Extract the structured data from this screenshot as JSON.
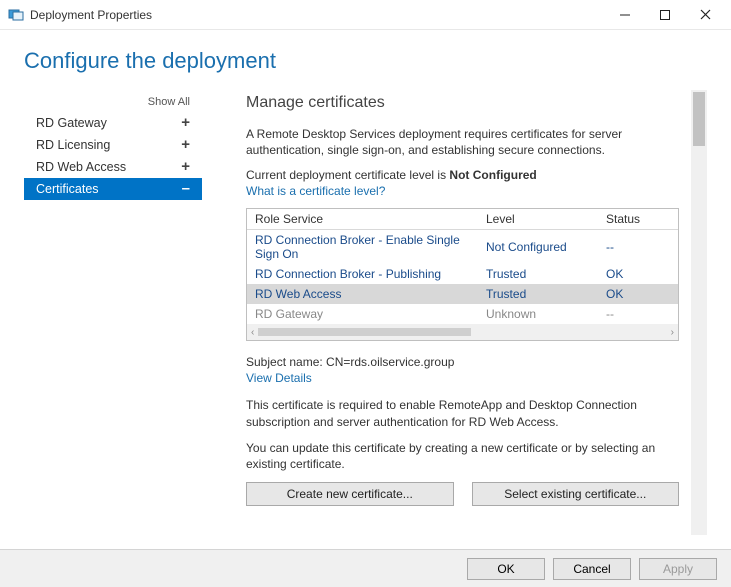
{
  "window": {
    "title": "Deployment Properties"
  },
  "heading": "Configure the deployment",
  "sidebar": {
    "show_all": "Show All",
    "items": [
      {
        "label": "RD Gateway",
        "expander": "+",
        "active": false
      },
      {
        "label": "RD Licensing",
        "expander": "+",
        "active": false
      },
      {
        "label": "RD Web Access",
        "expander": "+",
        "active": false
      },
      {
        "label": "Certificates",
        "expander": "–",
        "active": true
      }
    ]
  },
  "panel": {
    "title": "Manage certificates",
    "intro": "A Remote Desktop Services deployment requires certificates for server authentication, single sign-on, and establishing secure connections.",
    "status_line_prefix": "Current deployment certificate level is ",
    "status_value": "Not Configured",
    "what_link": "What is a certificate level?",
    "table": {
      "headers": {
        "role": "Role Service",
        "level": "Level",
        "status": "Status"
      },
      "rows": [
        {
          "role": "RD Connection Broker - Enable Single Sign On",
          "level": "Not Configured",
          "status": "--",
          "selected": false,
          "disabled": false
        },
        {
          "role": "RD Connection Broker - Publishing",
          "level": "Trusted",
          "status": "OK",
          "selected": false,
          "disabled": false
        },
        {
          "role": "RD Web Access",
          "level": "Trusted",
          "status": "OK",
          "selected": true,
          "disabled": false
        },
        {
          "role": "RD Gateway",
          "level": "Unknown",
          "status": "--",
          "selected": false,
          "disabled": true
        }
      ]
    },
    "subject_name": "Subject name: CN=rds.oilservice.group",
    "view_details": "View Details",
    "desc1": "This certificate is required to enable RemoteApp and Desktop Connection subscription and server authentication for RD Web Access.",
    "desc2": "You can update this certificate by creating a new certificate or by selecting an existing certificate.",
    "btn_create": "Create new certificate...",
    "btn_select": "Select existing certificate..."
  },
  "footer": {
    "ok": "OK",
    "cancel": "Cancel",
    "apply": "Apply"
  }
}
